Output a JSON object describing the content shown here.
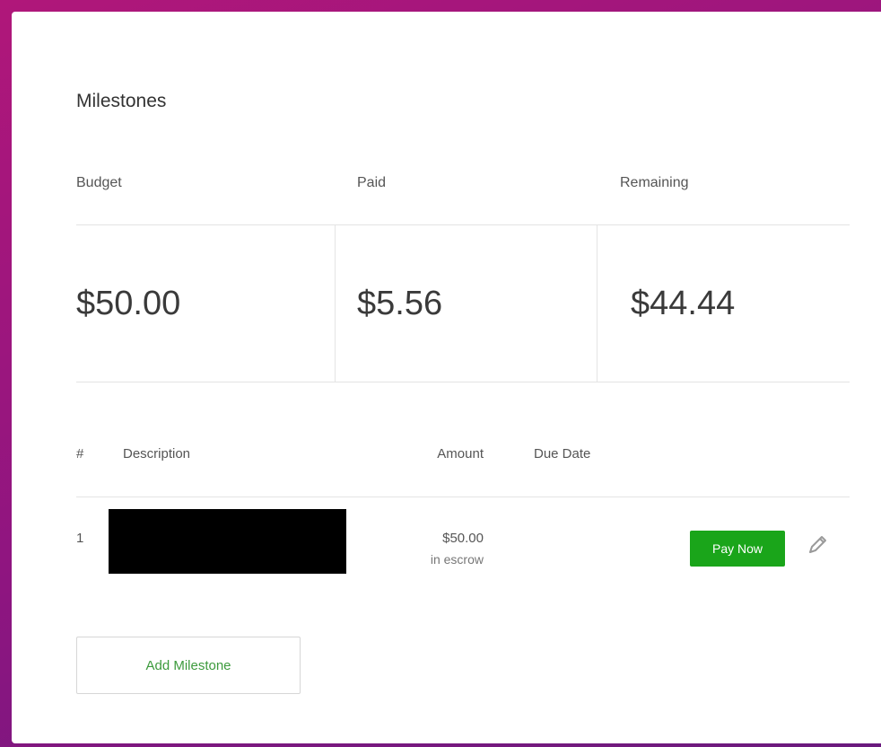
{
  "title": "Milestones",
  "summary": {
    "budget_label": "Budget",
    "paid_label": "Paid",
    "remaining_label": "Remaining",
    "budget_value": "$50.00",
    "paid_value": "$5.56",
    "remaining_value": "$44.44"
  },
  "table": {
    "headers": {
      "num": "#",
      "description": "Description",
      "amount": "Amount",
      "due_date": "Due Date"
    },
    "rows": [
      {
        "num": "1",
        "amount": "$50.00",
        "status": "in escrow",
        "action": "Pay Now"
      }
    ]
  },
  "add_button": "Add Milestone",
  "icons": {
    "edit": "pencil-icon"
  },
  "colors": {
    "accent": "#1aa51a",
    "link_green": "#3c9a3c"
  }
}
